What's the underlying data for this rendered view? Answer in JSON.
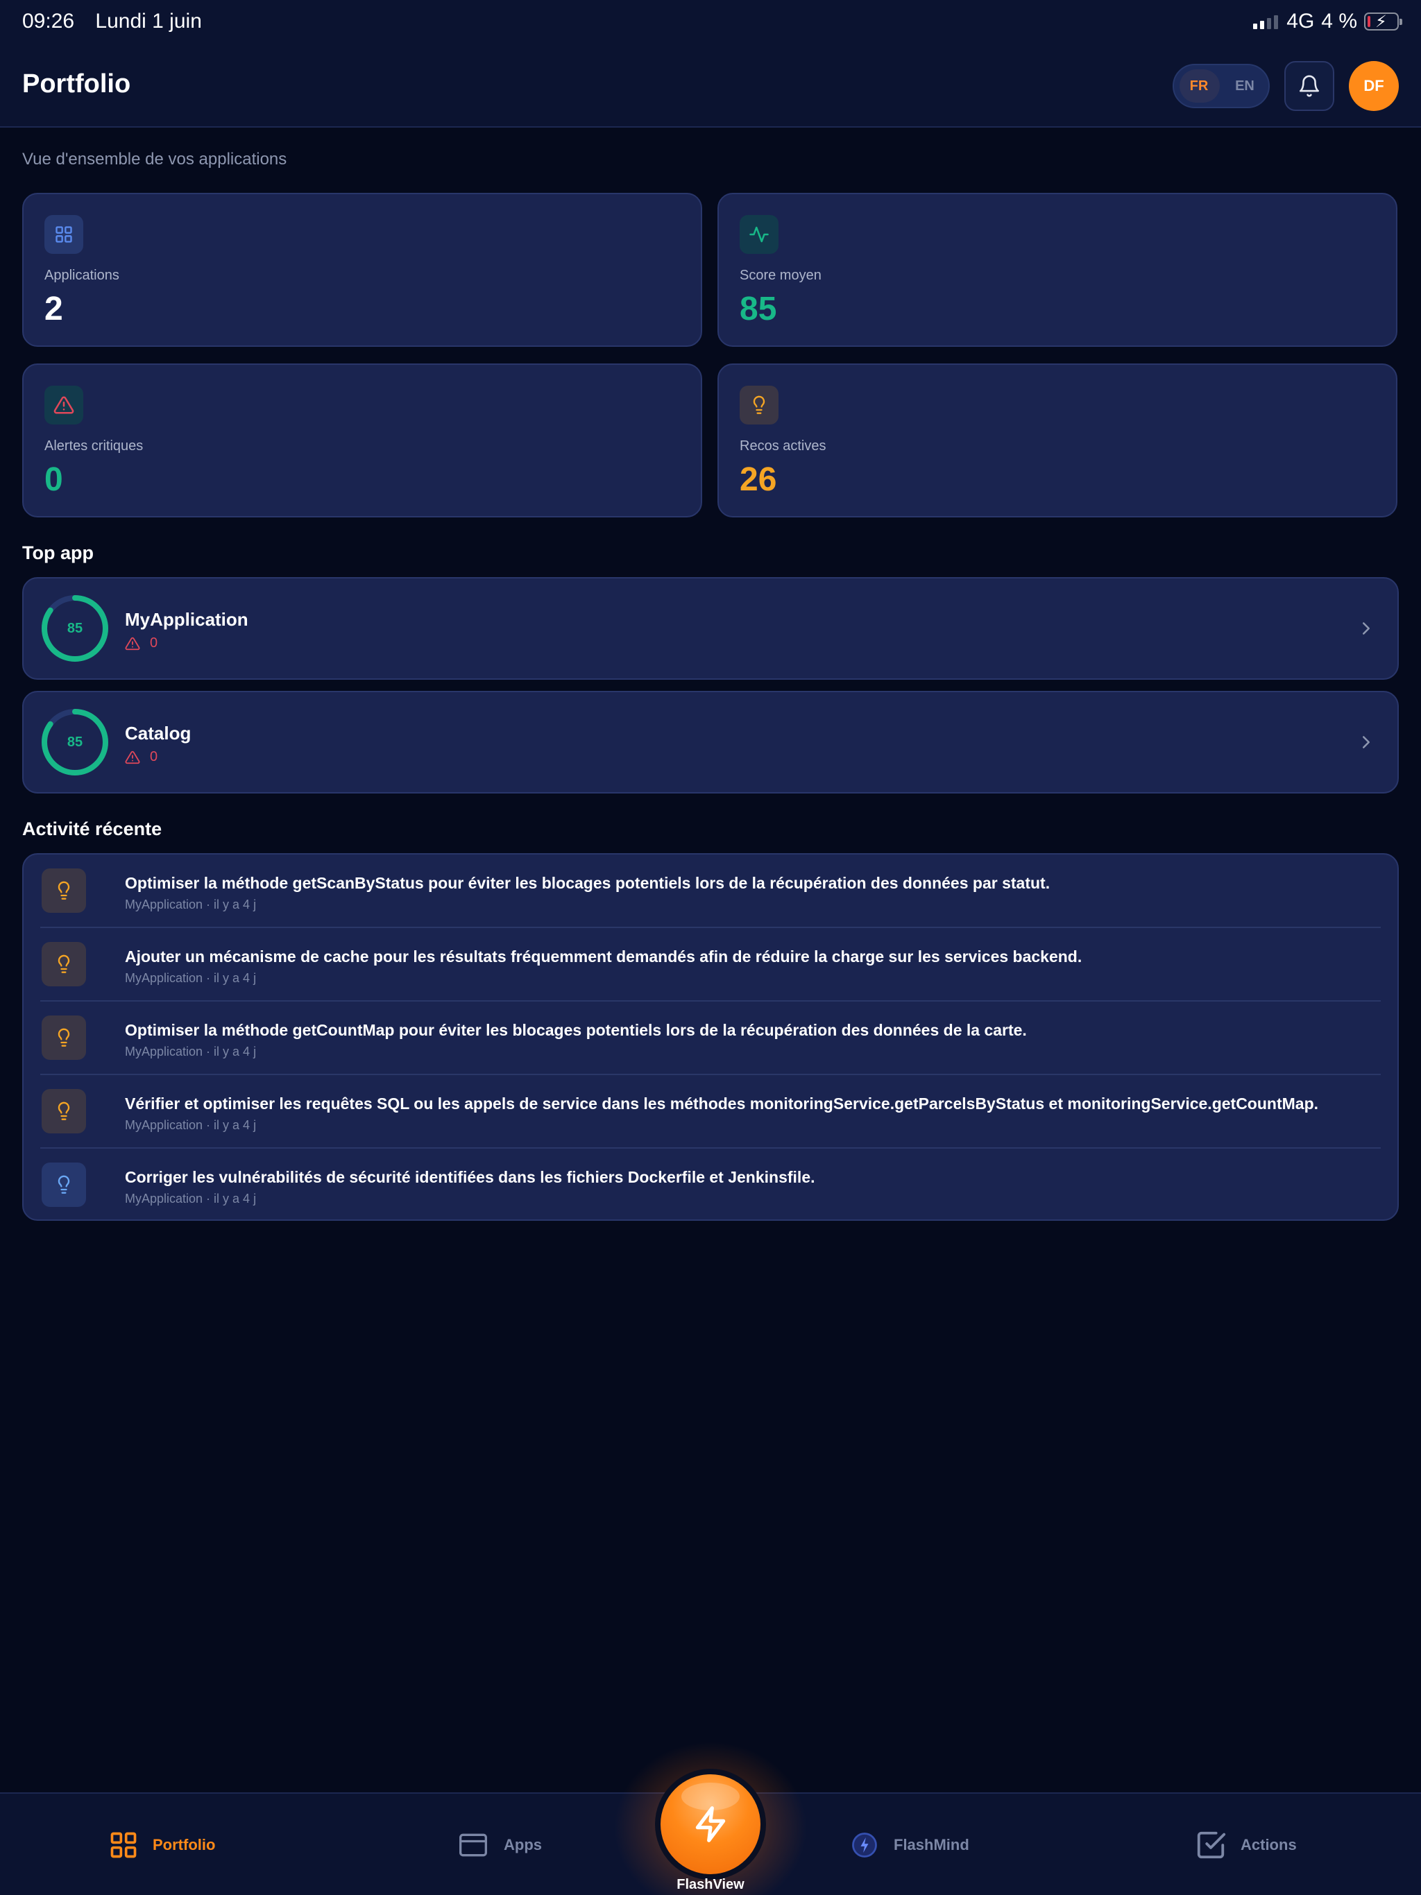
{
  "status_bar": {
    "time": "09:26",
    "date": "Lundi 1 juin",
    "network": "4G",
    "battery": "4 %"
  },
  "header": {
    "title": "Portfolio",
    "lang_fr": "FR",
    "lang_en": "EN",
    "avatar_initials": "DF"
  },
  "subtitle": "Vue d'ensemble de vos applications",
  "stats": [
    {
      "label": "Applications",
      "value": "2",
      "color": "#ffffff",
      "icon": "grid-icon"
    },
    {
      "label": "Score moyen",
      "value": "85",
      "color": "#18b888",
      "icon": "activity-icon"
    },
    {
      "label": "Alertes critiques",
      "value": "0",
      "color": "#18b888",
      "icon": "warning-icon"
    },
    {
      "label": "Recos actives",
      "value": "26",
      "color": "#f5a524",
      "icon": "lightbulb-icon"
    }
  ],
  "top_app": {
    "title": "Top app",
    "apps": [
      {
        "name": "MyApplication",
        "score": "85",
        "alerts": "0"
      },
      {
        "name": "Catalog",
        "score": "85",
        "alerts": "0"
      }
    ]
  },
  "activity": {
    "title": "Activité récente",
    "items": [
      {
        "text": "Optimiser la méthode getScanByStatus pour éviter les blocages potentiels lors de la récupération des données par statut.",
        "meta": "MyApplication · il y a 4 j",
        "tone": "orange"
      },
      {
        "text": "Ajouter un mécanisme de cache pour les résultats fréquemment demandés afin de réduire la charge sur les services backend.",
        "meta": "MyApplication · il y a 4 j",
        "tone": "orange"
      },
      {
        "text": "Optimiser la méthode getCountMap pour éviter les blocages potentiels lors de la récupération des données de la carte.",
        "meta": "MyApplication · il y a 4 j",
        "tone": "orange"
      },
      {
        "text": "Vérifier et optimiser les requêtes SQL ou les appels de service dans les méthodes monitoringService.getParcelsByStatus et monitoringService.getCountMap.",
        "meta": "MyApplication · il y a 4 j",
        "tone": "orange"
      },
      {
        "text": "Corriger les vulnérabilités de sécurité identifiées dans les fichiers Dockerfile et Jenkinsfile.",
        "meta": "MyApplication · il y a 4 j",
        "tone": "blue"
      }
    ]
  },
  "nav": {
    "portfolio": "Portfolio",
    "apps": "Apps",
    "flashview": "FlashView",
    "flashmind": "FlashMind",
    "actions": "Actions"
  },
  "colors": {
    "accent": "#ff8a18",
    "score": "#18b888",
    "alert": "#e0485a",
    "reco": "#f5a524",
    "card": "#1a2450"
  }
}
